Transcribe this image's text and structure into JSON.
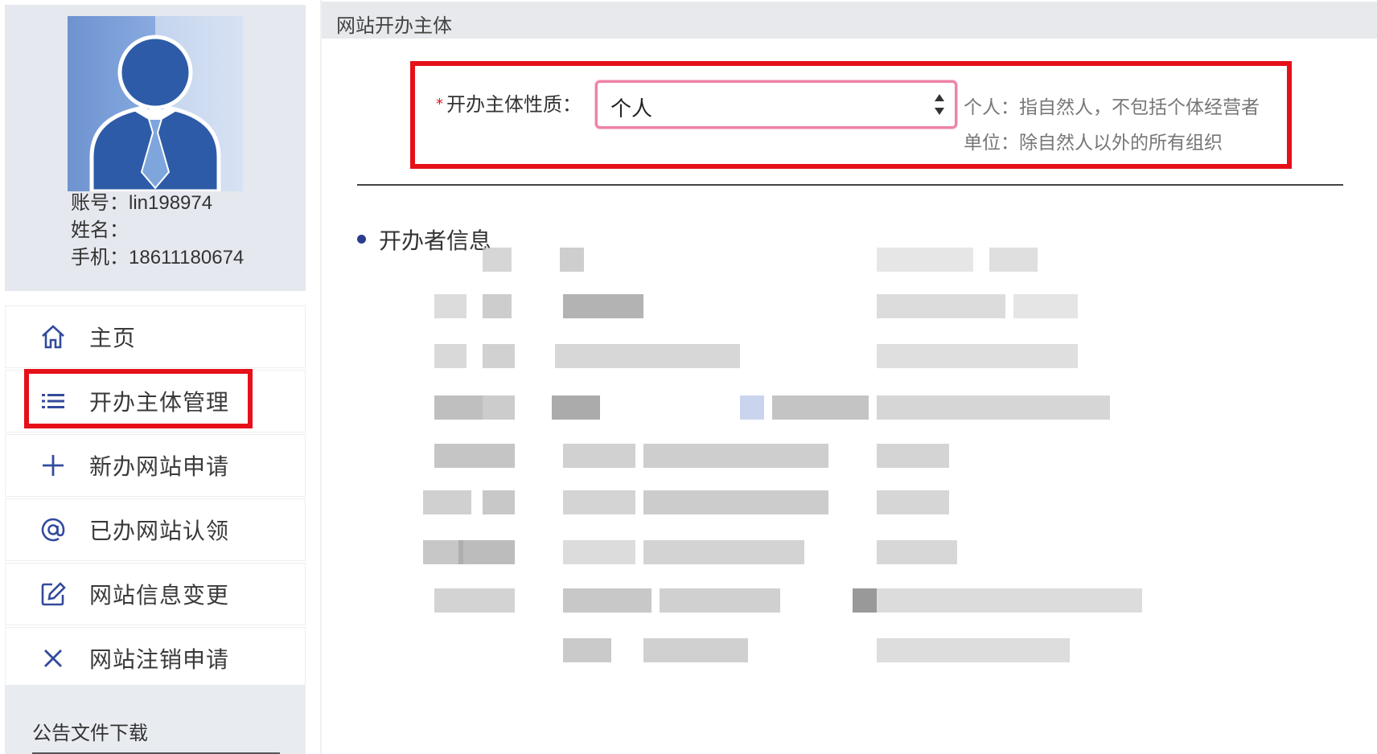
{
  "profile": {
    "account_label": "账号：",
    "account_value": "lin198974",
    "name_label": "姓名：",
    "name_value": "",
    "phone_label": "手机：",
    "phone_value": "18611180674"
  },
  "nav": {
    "items": [
      {
        "label": "主页",
        "icon": "home-icon"
      },
      {
        "label": "开办主体管理",
        "icon": "list-icon"
      },
      {
        "label": "新办网站申请",
        "icon": "plus-icon"
      },
      {
        "label": "已办网站认领",
        "icon": "at-icon"
      },
      {
        "label": "网站信息变更",
        "icon": "edit-icon"
      },
      {
        "label": "网站注销申请",
        "icon": "close-icon"
      }
    ],
    "highlighted_index": 1
  },
  "notice": {
    "title": "公告文件下载"
  },
  "main": {
    "header_title": "网站开办主体",
    "entity_type": {
      "required_mark": "*",
      "label": "开办主体性质：",
      "selected": "个人",
      "hint_personal": "个人：指自然人，不包括个体经营者",
      "hint_org": "单位：除自然人以外的所有组织"
    },
    "section_title": "开办者信息"
  },
  "colors": {
    "highlight_border": "#e5101a",
    "accent": "#2a3e8f",
    "select_border": "#ee82a8",
    "sidebar_bg": "#e5e8ee"
  }
}
